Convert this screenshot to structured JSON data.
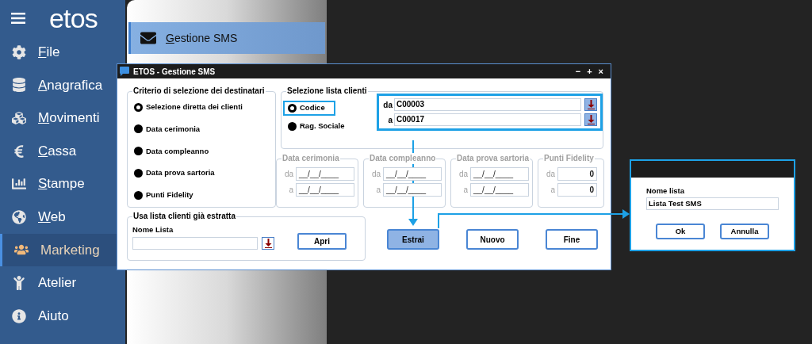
{
  "sidebar": {
    "logo": "etos",
    "items": [
      {
        "label": "File",
        "accelerator": true,
        "selected": false
      },
      {
        "label": "Anagrafica",
        "accelerator": true,
        "selected": false
      },
      {
        "label": "Movimenti",
        "accelerator": true,
        "selected": false
      },
      {
        "label": "Cassa",
        "accelerator": true,
        "selected": false
      },
      {
        "label": "Stampe",
        "accelerator": true,
        "selected": false
      },
      {
        "label": "Web",
        "accelerator": true,
        "selected": false
      },
      {
        "label": "Marketing",
        "accelerator": false,
        "selected": true
      },
      {
        "label": "Atelier",
        "accelerator": false,
        "selected": false
      },
      {
        "label": "Aiuto",
        "accelerator": false,
        "selected": false
      }
    ]
  },
  "submenu": {
    "items": [
      {
        "label": "Gestione SMS",
        "accelerator": true,
        "selected": true
      }
    ]
  },
  "dialog": {
    "title": "ETOS - Gestione SMS",
    "window_controls": [
      "−",
      "+",
      "×"
    ],
    "criteria": {
      "title": "Criterio di selezione dei destinatari",
      "options": [
        {
          "label": "Selezione diretta dei clienti",
          "selected": true
        },
        {
          "label": "Data cerimonia",
          "selected": false
        },
        {
          "label": "Data compleanno",
          "selected": false
        },
        {
          "label": "Data prova sartoria",
          "selected": false
        },
        {
          "label": "Punti Fidelity",
          "selected": false
        }
      ]
    },
    "client_list": {
      "title": "Selezione lista clienti",
      "options": [
        {
          "label": "Codice",
          "selected": true,
          "highlighted": true
        },
        {
          "label": "Rag. Sociale",
          "selected": false,
          "highlighted": false
        }
      ],
      "range_highlighted": true,
      "fields": [
        {
          "label": "da",
          "value": "C00003"
        },
        {
          "label": "a",
          "value": "C00017"
        }
      ]
    },
    "filters": [
      {
        "title": "Data cerimonia",
        "disabled": true,
        "kind": "date",
        "fields": [
          {
            "label": "da",
            "value": "__/__/____"
          },
          {
            "label": "a",
            "value": "__/__/____"
          }
        ]
      },
      {
        "title": "Data compleanno",
        "disabled": true,
        "kind": "date",
        "fields": [
          {
            "label": "da",
            "value": "__/__/____"
          },
          {
            "label": "a",
            "value": "__/__/____"
          }
        ]
      },
      {
        "title": "Data prova sartoria",
        "disabled": true,
        "kind": "date",
        "fields": [
          {
            "label": "da",
            "value": "__/__/____"
          },
          {
            "label": "a",
            "value": "__/__/____"
          }
        ]
      },
      {
        "title": "Punti Fidelity",
        "disabled": true,
        "kind": "number",
        "fields": [
          {
            "label": "da",
            "value": "0"
          },
          {
            "label": "a",
            "value": "0"
          }
        ]
      }
    ],
    "saved_list": {
      "title": "Usa lista clienti già estratta",
      "field_label": "Nome Lista",
      "button": "Apri"
    },
    "buttons": [
      {
        "label": "Estrai",
        "selected": true
      },
      {
        "label": "Nuovo",
        "selected": false
      },
      {
        "label": "Fine",
        "selected": false
      }
    ]
  },
  "name_dialog": {
    "field_label": "Nome lista",
    "value": "Lista Test SMS",
    "buttons": [
      {
        "label": "Ok"
      },
      {
        "label": "Annulla"
      }
    ]
  }
}
